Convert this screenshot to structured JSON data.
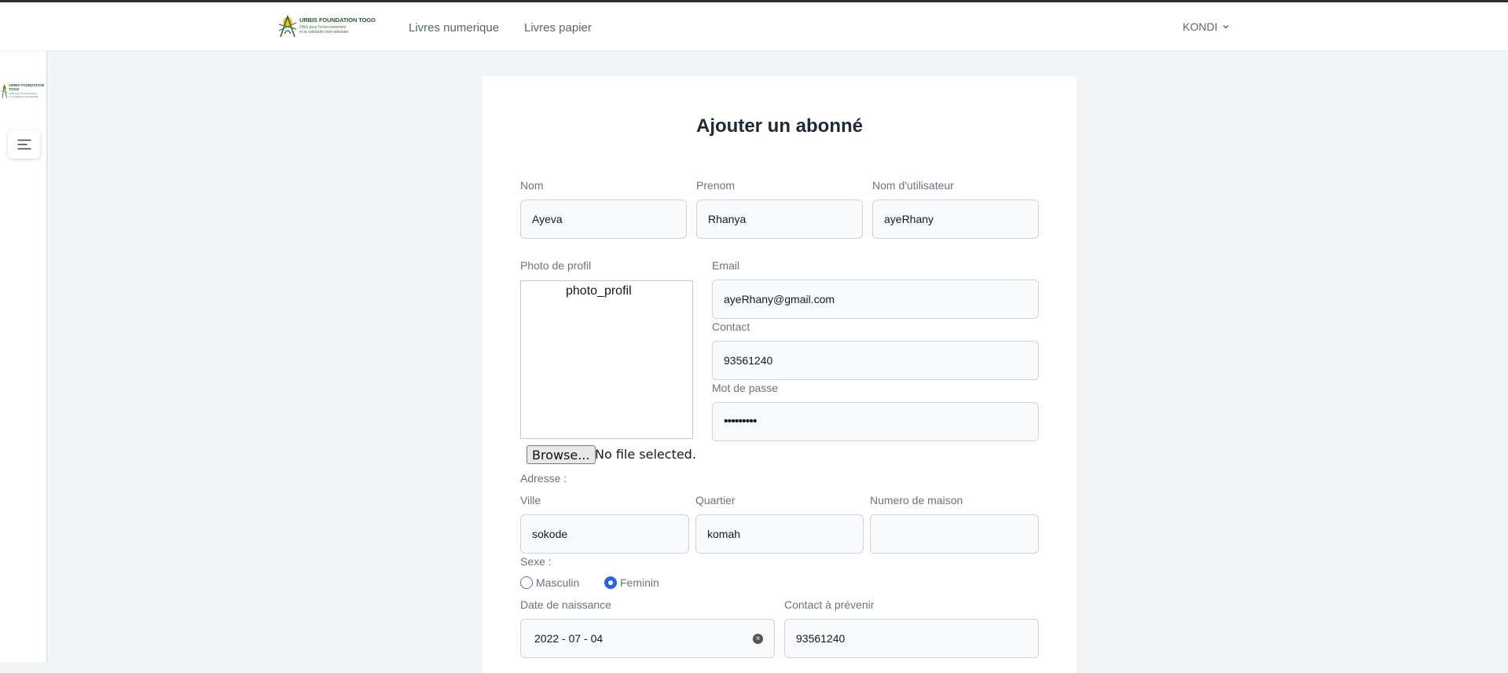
{
  "brand": {
    "title": "URBIS FOUNDATION TOGO",
    "subtitle_line1": "ONG pour l'environnement",
    "subtitle_line2": "et la solidarité internationale"
  },
  "nav": {
    "links": [
      "Livres numerique",
      "Livres papier"
    ],
    "user": "KONDI"
  },
  "form": {
    "title": "Ajouter un abonné",
    "nom_label": "Nom",
    "nom_value": "Ayeva",
    "prenom_label": "Prenom",
    "prenom_value": "Rhanya",
    "username_label": "Nom d'utilisateur",
    "username_value": "ayeRhany",
    "photo_label": "Photo de profil",
    "photo_alt": "photo_profil",
    "browse_label": "Browse...",
    "no_file": "No file selected.",
    "email_label": "Email",
    "email_value": "ayeRhany@gmail.com",
    "contact_label": "Contact",
    "contact_value": "93561240",
    "password_label": "Mot de passe",
    "password_value": "•••••••••",
    "adresse_label": "Adresse :",
    "ville_label": "Ville",
    "ville_value": "sokode",
    "quartier_label": "Quartier",
    "quartier_value": "komah",
    "maison_label": "Numero de maison",
    "maison_value": "",
    "sexe_label": "Sexe :",
    "sexe_options": [
      "Masculin",
      "Feminin"
    ],
    "sexe_selected": "Feminin",
    "naissance_label": "Date de naissance",
    "naissance_value": "2022 - 07 - 04",
    "urgence_label": "Contact à prévenir",
    "urgence_value": "93561240"
  },
  "colors": {
    "brand_green": "#1f5e2e",
    "radio_accent": "#2563eb",
    "sidebar_border": "#d8ecdf"
  }
}
